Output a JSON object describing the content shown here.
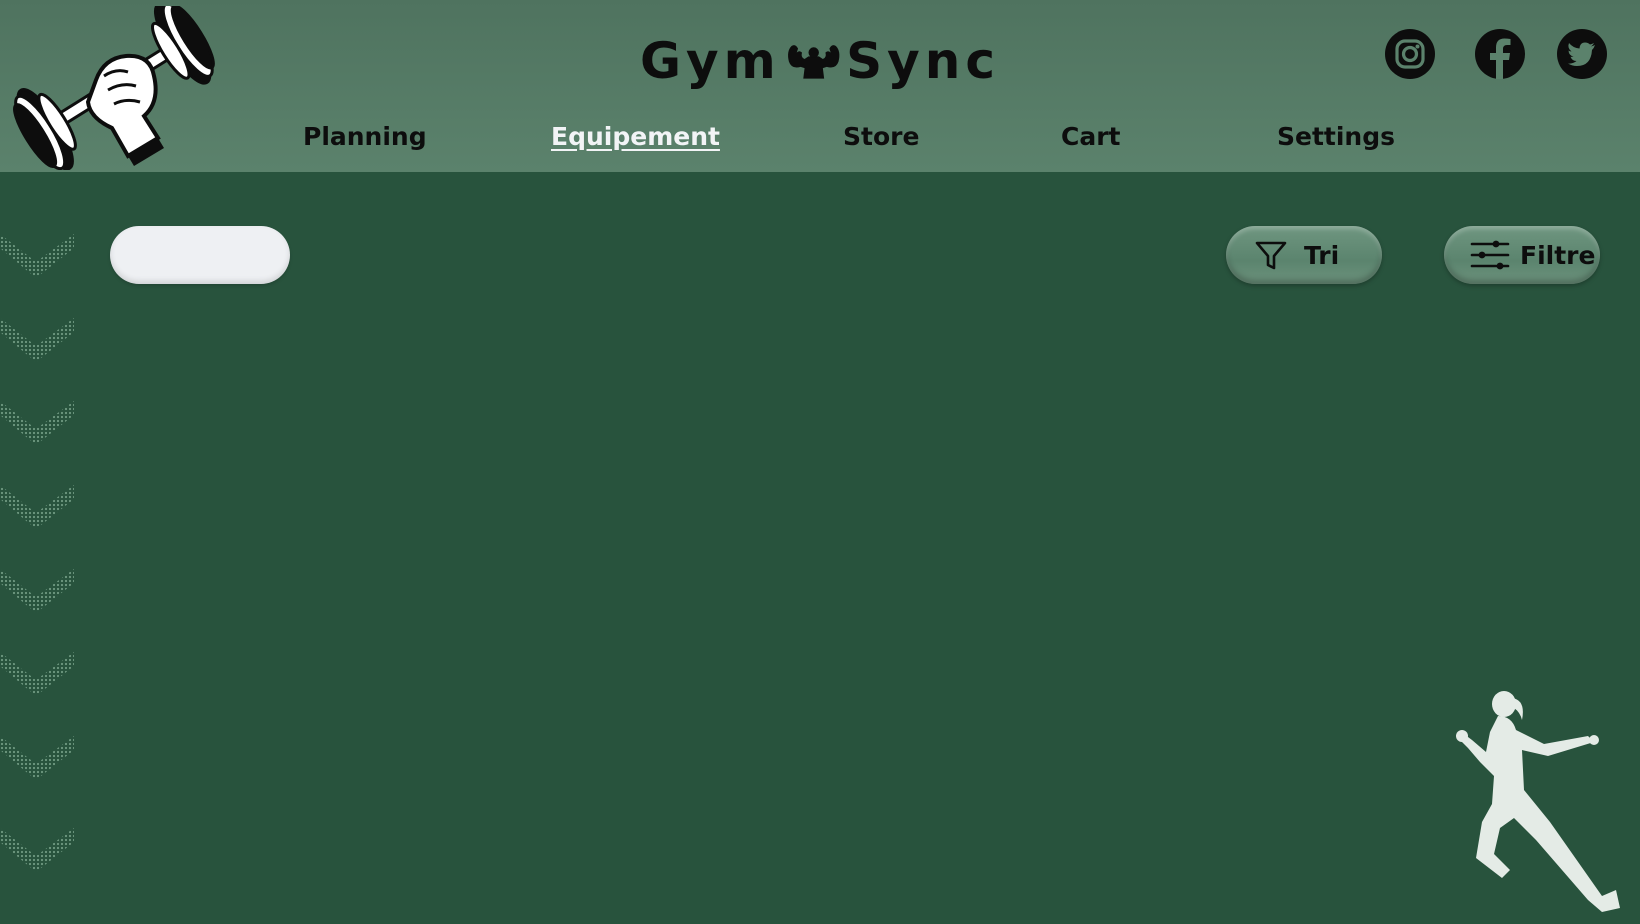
{
  "brand": {
    "name_left": "Gym",
    "name_right": "Sync",
    "icon": "flexing-muscle-icon"
  },
  "logo": {
    "icon": "dumbbell-fist-icon"
  },
  "social": [
    {
      "name": "Instagram",
      "icon": "instagram-icon"
    },
    {
      "name": "Facebook",
      "icon": "facebook-icon"
    },
    {
      "name": "Twitter",
      "icon": "twitter-icon"
    }
  ],
  "nav": {
    "items": [
      {
        "label": "Planning",
        "active": false
      },
      {
        "label": "Equipement",
        "active": true
      },
      {
        "label": "Store",
        "active": false
      },
      {
        "label": "Cart",
        "active": false
      },
      {
        "label": "Settings",
        "active": false
      }
    ]
  },
  "toolbar": {
    "search": {
      "value": "",
      "placeholder": ""
    },
    "sort_button": {
      "label": "Tri",
      "icon": "funnel-icon"
    },
    "filter_button": {
      "label": "Filtre",
      "icon": "sliders-icon"
    }
  },
  "decor": {
    "side_pattern": "chevron-down-icon",
    "runner": "runner-silhouette-icon"
  },
  "colors": {
    "header_bg": "#5b826c",
    "page_bg": "#28533d",
    "text_dark": "#0d0d0d",
    "text_active": "#f2f4f6",
    "search_bg": "#eef0f3",
    "button_bg": "#5b846e",
    "runner_fill": "#e4ebe6"
  }
}
